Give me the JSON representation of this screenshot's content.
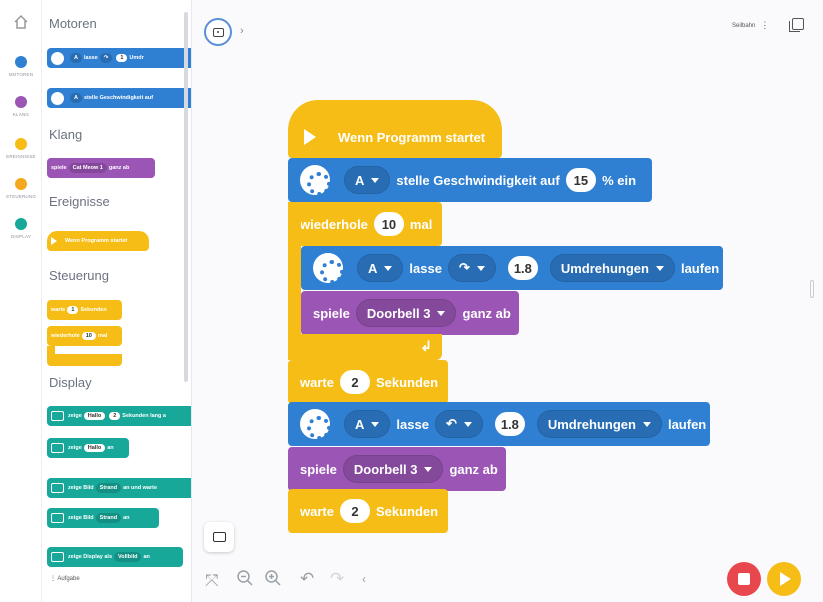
{
  "categories": [
    {
      "label": "MOTOREN",
      "color": "#2f7fd2"
    },
    {
      "label": "KLANG",
      "color": "#9a55b5"
    },
    {
      "label": "EREIGNISSE",
      "color": "#f6bd16"
    },
    {
      "label": "STEUERUNG",
      "color": "#f4a81d"
    },
    {
      "label": "DISPLAY",
      "color": "#18a89a"
    }
  ],
  "palette": {
    "sections": {
      "motoren": "Motoren",
      "klang": "Klang",
      "ereignisse": "Ereignisse",
      "steuerung": "Steuerung",
      "display": "Display"
    },
    "motor_run": {
      "port": "A",
      "verb": "lasse",
      "value": "1",
      "unit": "Umdr"
    },
    "motor_speed": {
      "port": "A",
      "text": "stelle Geschwindigkeit auf"
    },
    "sound": {
      "verb": "spiele",
      "sound": "Cat Meow 1",
      "tail": "ganz ab"
    },
    "event": {
      "text": "Wenn Programm startet"
    },
    "wait": {
      "verb": "warte",
      "value": "1",
      "unit": "Sekunden"
    },
    "repeat": {
      "verb": "wiederhole",
      "value": "10",
      "unit": "mal"
    },
    "disp1": {
      "verb": "zeige",
      "text": "Hallo",
      "value": "2",
      "tail": "Sekunden lang a"
    },
    "disp2": {
      "verb": "zeige",
      "text": "Hallo",
      "tail": "an"
    },
    "disp3": {
      "verb": "zeige Bild",
      "img": "Strand",
      "tail": "an und warte"
    },
    "disp4": {
      "verb": "zeige Bild",
      "img": "Strand",
      "tail": "an"
    },
    "disp5": {
      "verb": "zeige Display als",
      "mode": "Vollbild",
      "tail": "an"
    },
    "footer": "Aufgabe"
  },
  "topbar": {
    "right_label": "Seilbahn"
  },
  "program": {
    "hat": "Wenn Programm startet",
    "speed": {
      "port": "A",
      "text": "stelle Geschwindigkeit auf",
      "value": "15",
      "unit": "% ein"
    },
    "repeat": {
      "verb": "wiederhole",
      "value": "10",
      "unit": "mal"
    },
    "run1": {
      "port": "A",
      "verb": "lasse",
      "dir": "↷",
      "value": "1.8",
      "unit": "Umdrehungen",
      "tail": "laufen"
    },
    "play1": {
      "verb": "spiele",
      "sound": "Doorbell 3",
      "tail": "ganz ab"
    },
    "wait1": {
      "verb": "warte",
      "value": "2",
      "unit": "Sekunden"
    },
    "run2": {
      "port": "A",
      "verb": "lasse",
      "dir": "↶",
      "value": "1.8",
      "unit": "Umdrehungen",
      "tail": "laufen"
    },
    "play2": {
      "verb": "spiele",
      "sound": "Doorbell 3",
      "tail": "ganz ab"
    },
    "wait2": {
      "verb": "warte",
      "value": "2",
      "unit": "Sekunden"
    }
  }
}
